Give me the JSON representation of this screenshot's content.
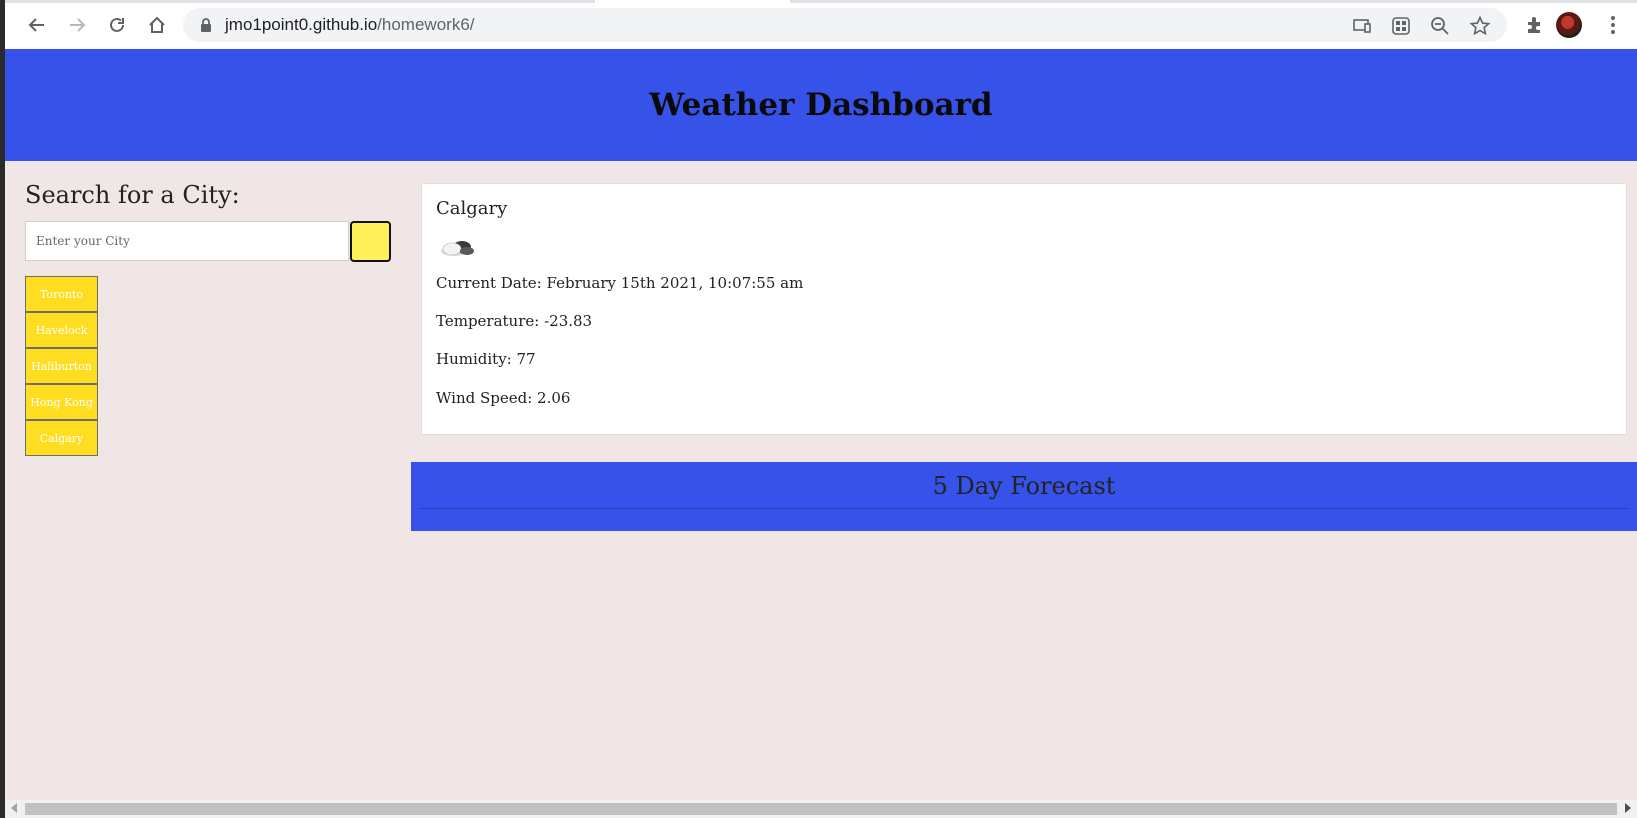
{
  "browser": {
    "url_host": "jmo1point0.github.io",
    "url_path": "/homework6/",
    "icons": [
      "back-icon",
      "forward-icon",
      "reload-icon",
      "home-icon",
      "lock-icon",
      "cast-icon",
      "qr-icon",
      "zoom-out-icon",
      "star-icon",
      "extensions-icon",
      "avatar",
      "menu-icon"
    ]
  },
  "header": {
    "title": "Weather Dashboard",
    "color": "#3652e8"
  },
  "search": {
    "title": "Search for a City:",
    "placeholder": "Enter your City",
    "value": "",
    "button_color": "#fff05a"
  },
  "history": {
    "cities": [
      "Toronto",
      "Havelock",
      "Haliburton",
      "Hong Kong",
      "Calgary"
    ],
    "button_color": "#ffde21"
  },
  "current": {
    "city": "Calgary",
    "icon": "cloud-icon",
    "date_line": "Current Date: February 15th 2021, 10:07:55 am",
    "temperature_line": "Temperature: -23.83",
    "humidity_line": "Humidity: 77",
    "wind_line": "Wind Speed: 2.06"
  },
  "forecast": {
    "title": "5 Day Forecast"
  }
}
